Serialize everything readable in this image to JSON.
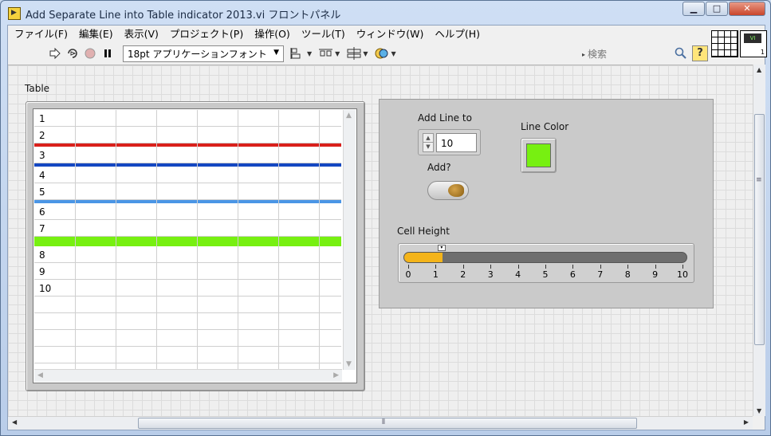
{
  "window": {
    "title": "Add Separate Line into Table indicator 2013.vi フロントパネル",
    "minimize": "▁",
    "maximize": "□",
    "close": "✕"
  },
  "menu": {
    "items": [
      "ファイル(F)",
      "編集(E)",
      "表示(V)",
      "プロジェクト(P)",
      "操作(O)",
      "ツール(T)",
      "ウィンドウ(W)",
      "ヘルプ(H)"
    ]
  },
  "toolbar": {
    "font_value": "18pt アプリケーションフォント",
    "search_placeholder": "検索",
    "help_label": "?"
  },
  "vi_icon": {
    "screen_text": "VI",
    "number": "1"
  },
  "table": {
    "label": "Table",
    "rows": [
      "1",
      "2",
      "",
      "3",
      "",
      "4",
      "5",
      "",
      "6",
      "7",
      "",
      "8",
      "9",
      "10",
      "",
      "",
      "",
      ""
    ],
    "separators": [
      {
        "after_row": "2",
        "color": "#d9201b"
      },
      {
        "after_row": "3",
        "color": "#1447c2"
      },
      {
        "after_row": "5",
        "color": "#4a96e6"
      },
      {
        "after_row": "7",
        "color": "#77f011"
      }
    ]
  },
  "controls": {
    "add_line_to": {
      "label": "Add Line to",
      "value": "10"
    },
    "line_color": {
      "label": "Line Color",
      "value": "#77f011"
    },
    "add": {
      "label": "Add?"
    },
    "cell_height": {
      "label": "Cell Height",
      "value": 1.4,
      "min": 0,
      "max": 10,
      "ticks": [
        "0",
        "1",
        "2",
        "3",
        "4",
        "5",
        "6",
        "7",
        "8",
        "9",
        "10"
      ]
    }
  },
  "colors": {
    "slider_fill": "#f4b41a",
    "slider_track": "#6e6e6e"
  }
}
